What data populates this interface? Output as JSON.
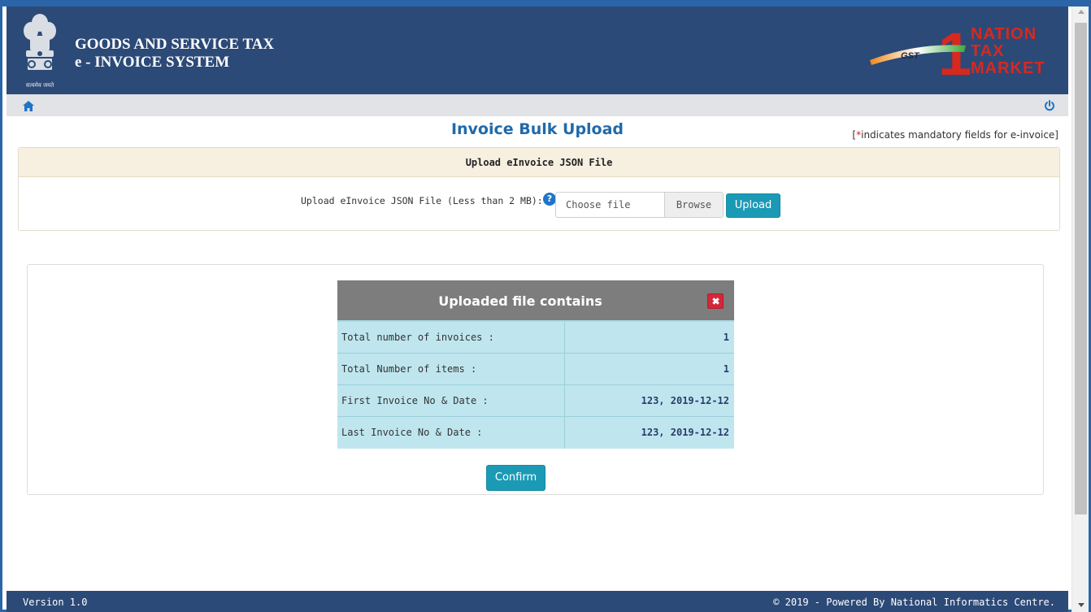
{
  "header": {
    "title_line1": "GOODS AND SERVICE TAX",
    "title_line2": "e - INVOICE SYSTEM",
    "emblem_caption": "सत्यमेव जयते",
    "logo_text_gst": "GST",
    "logo_text_nation": "NATION",
    "logo_text_tax": "TAX",
    "logo_text_market": "MARKET",
    "logo_number": "1",
    "colors": {
      "background": "#2c4a78",
      "logo_red": "#d9281d"
    }
  },
  "toolbar": {
    "home_icon": "home-icon",
    "power_icon": "power-icon"
  },
  "page": {
    "title": "Invoice Bulk Upload",
    "mandatory_prefix": "[",
    "mandatory_star": "*",
    "mandatory_text": "indicates mandatory fields for e-invoice]"
  },
  "upload_panel": {
    "heading": "Upload eInvoice JSON File",
    "field_label": "Upload eInvoice JSON File (Less than 2 MB):",
    "help_icon": "?",
    "file_placeholder": "Choose file",
    "browse_label": "Browse",
    "upload_label": "Upload"
  },
  "summary": {
    "heading": "Uploaded file contains",
    "rows": [
      {
        "label": "Total number of invoices :",
        "value": "1"
      },
      {
        "label": "Total Number of items :",
        "value": "1"
      },
      {
        "label": "First Invoice No & Date :",
        "value": "123, 2019-12-12"
      },
      {
        "label": "Last Invoice No & Date :",
        "value": "123, 2019-12-12"
      }
    ],
    "confirm_label": "Confirm"
  },
  "footer": {
    "version": "Version 1.0",
    "copyright": "© 2019 - Powered By National Informatics Centre."
  },
  "accent_colors": {
    "button": "#1b9ab6",
    "title_blue": "#1f6aab",
    "table_cell": "#bfe6ee"
  }
}
